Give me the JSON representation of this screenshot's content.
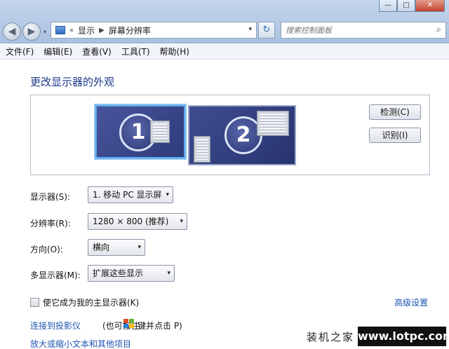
{
  "window": {
    "minimize": "—",
    "maximize": "□",
    "close": "✕"
  },
  "nav": {
    "back": "◀",
    "forward": "▶",
    "dropdown": "▾"
  },
  "address": {
    "prefix": "«",
    "crumbs": [
      "显示",
      "屏幕分辨率"
    ],
    "sep": "▶",
    "dropdown": "▾"
  },
  "refresh": "↻",
  "search": {
    "placeholder": "搜索控制面板",
    "icon": "⌕"
  },
  "menu": [
    "文件(F)",
    "编辑(E)",
    "查看(V)",
    "工具(T)",
    "帮助(H)"
  ],
  "page_title": "更改显示器的外观",
  "monitors": [
    {
      "number": "1"
    },
    {
      "number": "2"
    }
  ],
  "buttons": {
    "detect": "检测(C)",
    "identify": "识别(I)"
  },
  "fields": {
    "display": {
      "label": "显示器(S):",
      "value": "1. 移动 PC 显示屏"
    },
    "resolution": {
      "label": "分辨率(R):",
      "value": "1280 × 800 (推荐)"
    },
    "orientation": {
      "label": "方向(O):",
      "value": "横向"
    },
    "multiple": {
      "label": "多显示器(M):",
      "value": "扩展这些显示"
    },
    "arrow": "▾"
  },
  "checkbox": {
    "label": "使它成为我的主显示器(K)",
    "checked": false
  },
  "advanced_link": "高级设置",
  "projector": {
    "link": "连接到投影仪",
    "rest1": "(也可按住",
    "rest2": "键并点击 P)"
  },
  "text_size_link": "放大或缩小文本和其他项目",
  "watermark": {
    "cn": "装机之家",
    "url": "www.lotpc.com"
  },
  "colors": {
    "link": "#1e55b3",
    "title": "#1e3a8a"
  }
}
